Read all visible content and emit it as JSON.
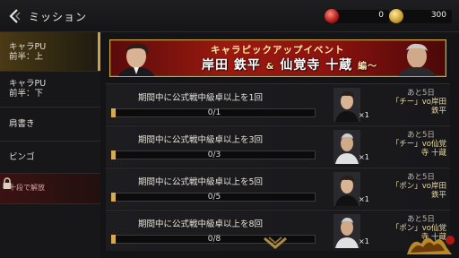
{
  "header": {
    "title": "ミッション",
    "currency_red": "0",
    "currency_gold": "300"
  },
  "sidebar": {
    "items": [
      {
        "label": "キャラPU\n前半：上"
      },
      {
        "label": "キャラPU\n前半：下"
      },
      {
        "label": "肩書き"
      },
      {
        "label": "ビンゴ"
      }
    ],
    "locked_label": "十段で解放"
  },
  "banner": {
    "line1": "キャラピックアップイベント",
    "line2a": "岸田 鉄平",
    "amp": "&",
    "line2b": "仙覚寺 十蔵",
    "suffix": "編～"
  },
  "missions": [
    {
      "text": "期間中に公式戦中級卓以上を1回",
      "count": "0/1",
      "days": "あと5日",
      "qty": "×1",
      "reward": "「チー」vo岸田\n鉄平"
    },
    {
      "text": "期間中に公式戦中級卓以上を3回",
      "count": "0/3",
      "days": "あと5日",
      "qty": "×1",
      "reward": "「チー」vo仙覚\n寺 十蔵"
    },
    {
      "text": "期間中に公式戦中級卓以上を5回",
      "count": "0/5",
      "days": "あと5日",
      "qty": "×1",
      "reward": "「ポン」vo岸田\n鉄平"
    },
    {
      "text": "期間中に公式戦中級卓以上を8回",
      "count": "0/8",
      "days": "あと5日",
      "qty": "×1",
      "reward": "「ポン」vo仙覚\n寺 十蔵"
    }
  ],
  "colors": {
    "accent_gold": "#c9a24a",
    "banner_red": "#9b1a10",
    "bg": "#141416"
  }
}
